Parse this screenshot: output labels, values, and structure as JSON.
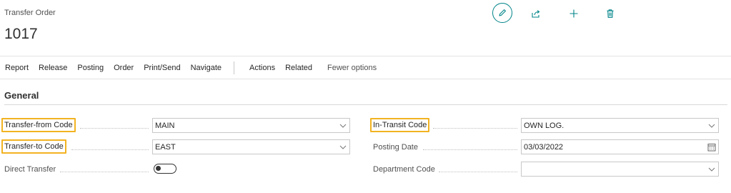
{
  "header": {
    "page_kind": "Transfer Order",
    "record_no": "1017",
    "actions": [
      {
        "icon": "pencil-icon",
        "name": "edit"
      },
      {
        "icon": "share-icon",
        "name": "share"
      },
      {
        "icon": "plus-icon",
        "name": "new"
      },
      {
        "icon": "trash-icon",
        "name": "delete"
      }
    ]
  },
  "menu": {
    "items": [
      "Report",
      "Release",
      "Posting",
      "Order",
      "Print/Send",
      "Navigate"
    ],
    "items2": [
      "Actions",
      "Related"
    ],
    "fewer_options": "Fewer options"
  },
  "section": {
    "title": "General"
  },
  "fields": {
    "transfer_from": {
      "label": "Transfer-from Code",
      "value": "MAIN",
      "control": "dropdown",
      "highlighted": true
    },
    "transfer_to": {
      "label": "Transfer-to Code",
      "value": "EAST",
      "control": "dropdown",
      "highlighted": true
    },
    "direct_transfer": {
      "label": "Direct Transfer",
      "value": false,
      "control": "toggle"
    },
    "in_transit": {
      "label": "In-Transit Code",
      "value": "OWN LOG.",
      "control": "dropdown",
      "highlighted": true
    },
    "posting_date": {
      "label": "Posting Date",
      "value": "03/03/2022",
      "control": "date"
    },
    "department": {
      "label": "Department Code",
      "value": "",
      "control": "dropdown"
    }
  },
  "colors": {
    "accent": "#008489",
    "highlight": "#f2b322"
  }
}
